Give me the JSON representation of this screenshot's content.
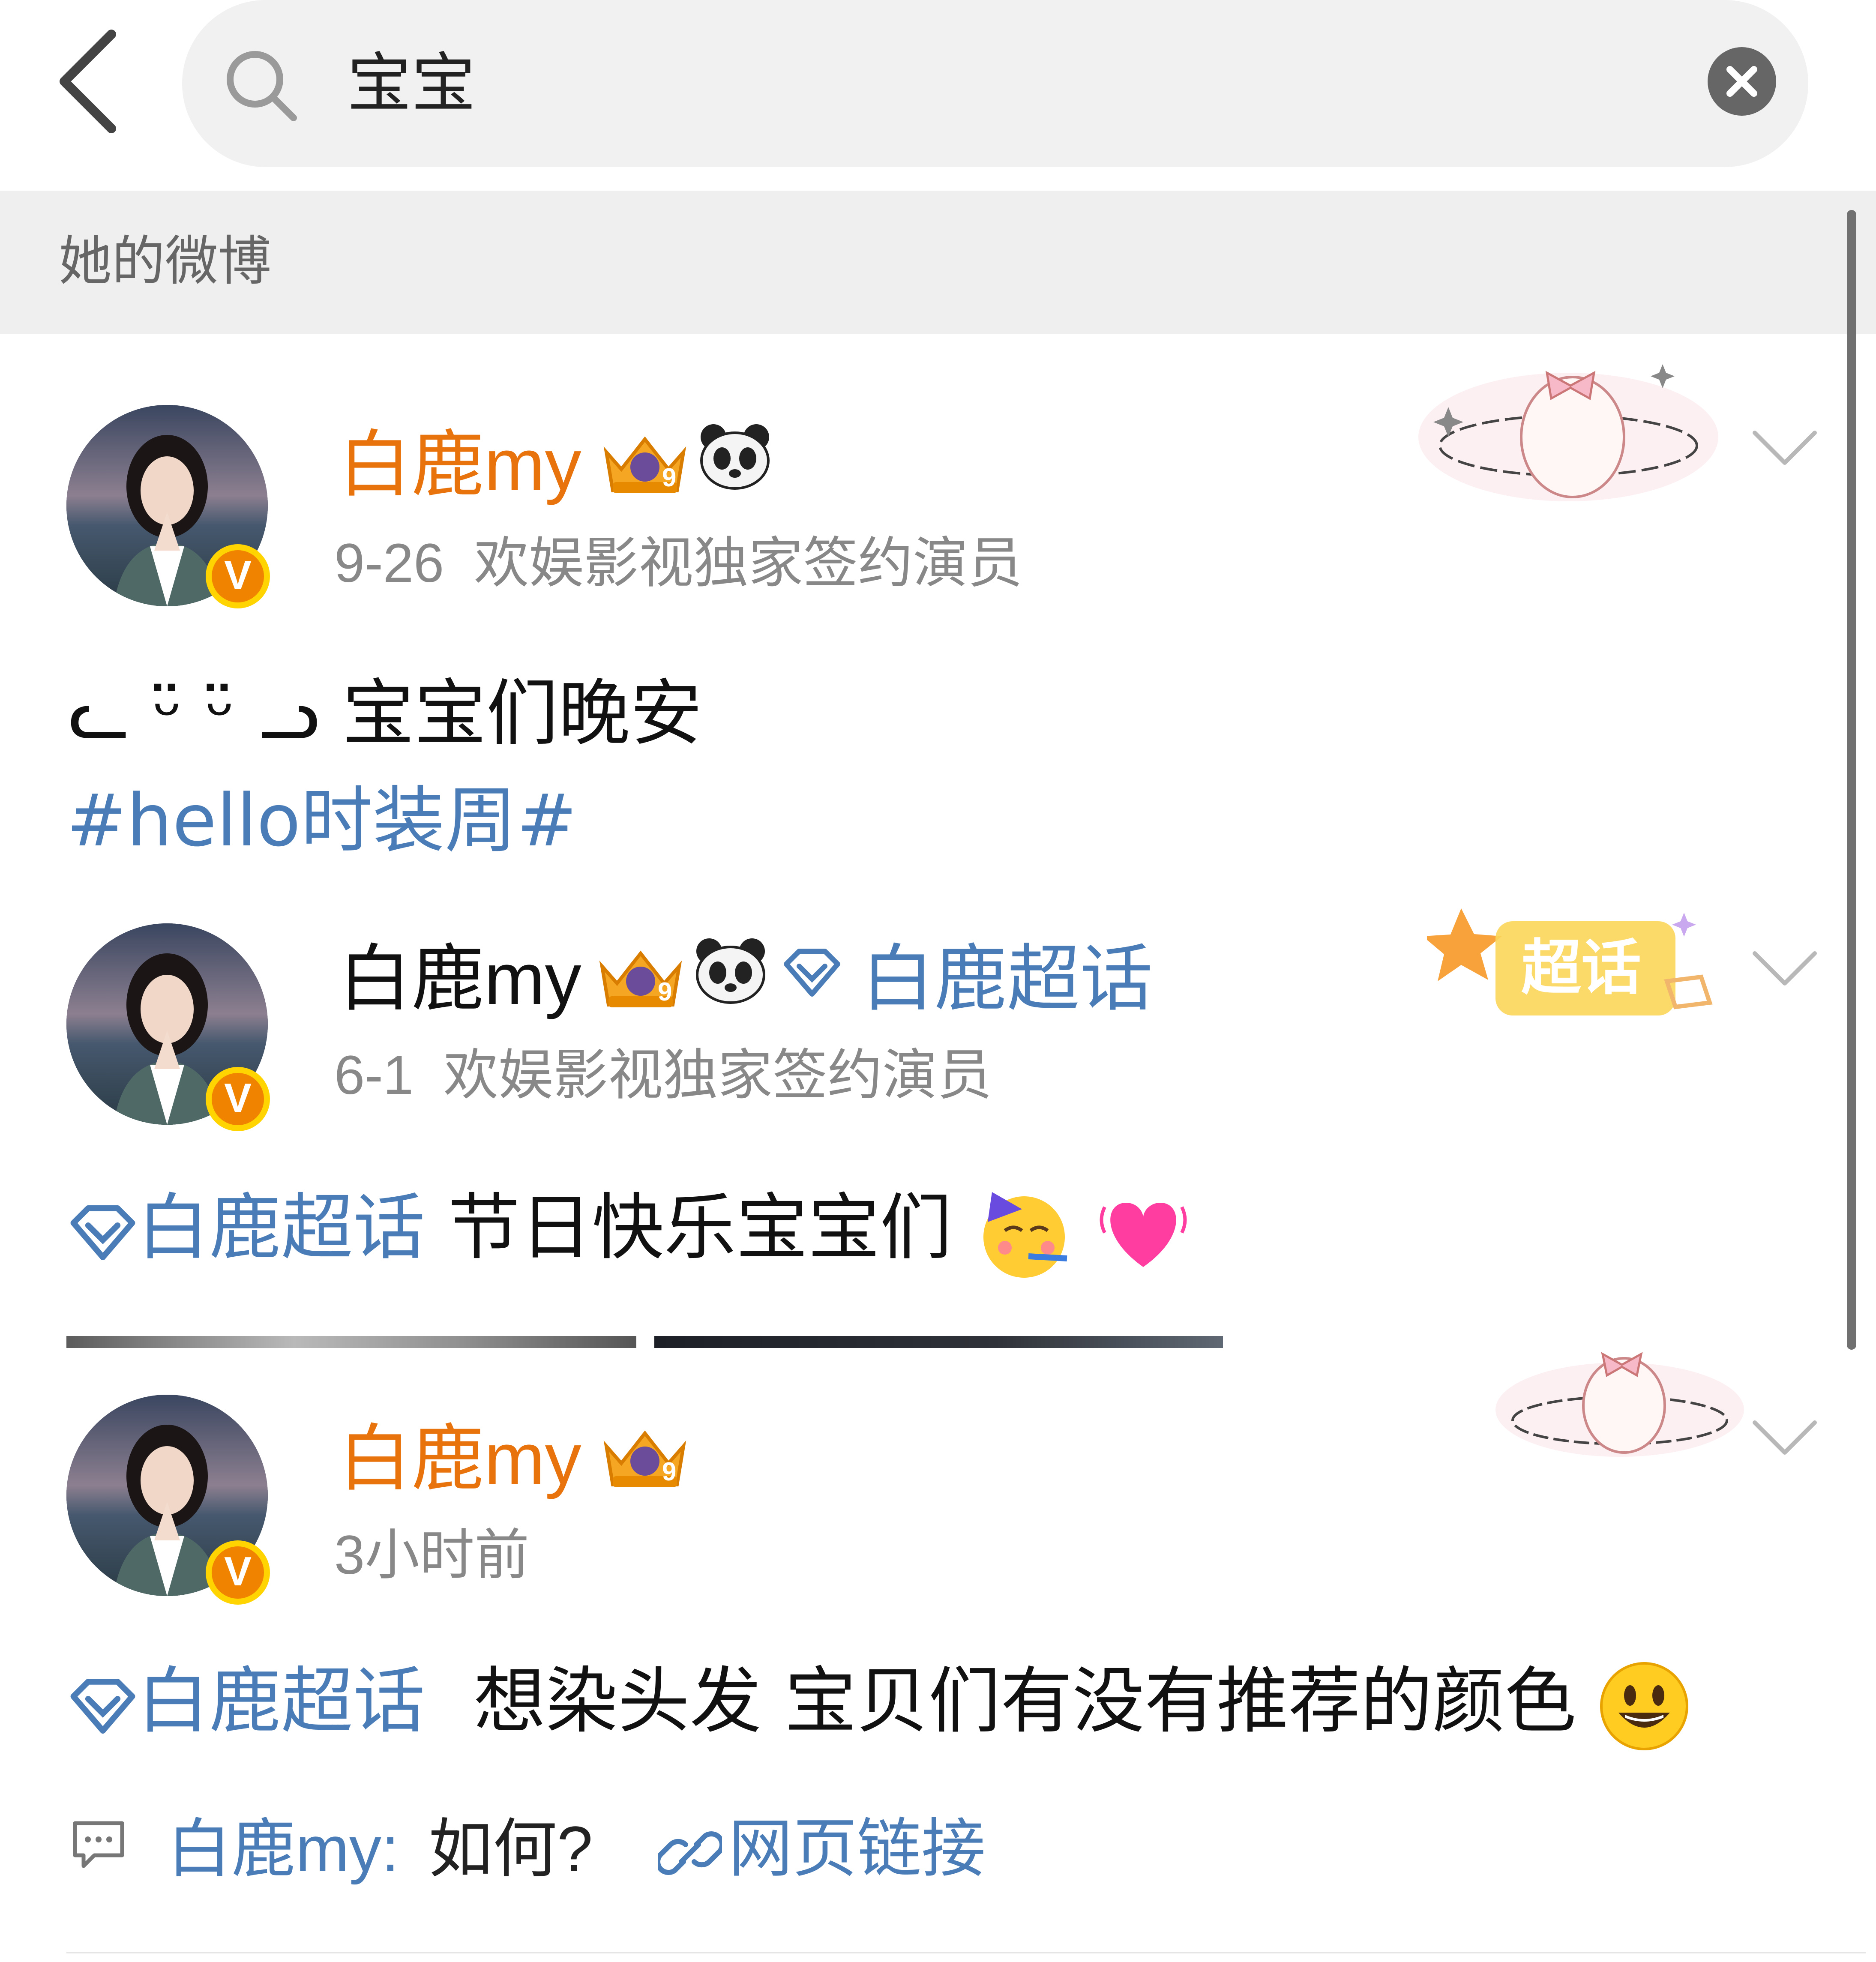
{
  "header": {
    "search_query": "宝宝"
  },
  "section": {
    "title": "她的微博"
  },
  "posts": [
    {
      "username": "白鹿my",
      "username_color": "#e8720c",
      "date": "9-26",
      "source": "欢娱影视独家签约演员",
      "text_prefix": "ᓚ ᵕ̈ ᵕ̈ ᓗ",
      "text": "宝宝们晚安",
      "hashtag": "#hello时装周#",
      "badge_level": "9",
      "verified_badge": "V",
      "decor": "bunny-sticker"
    },
    {
      "username": "白鹿my",
      "username_color": "#111111",
      "date": "6-1",
      "source": "欢娱影视独家签约演员",
      "supertopic_name": "白鹿超话",
      "text_topic": "白鹿超话",
      "text": "节日快乐宝宝们",
      "badge_level": "9",
      "verified_badge": "V",
      "decor_label": "超话"
    },
    {
      "username": "白鹿my",
      "username_color": "#e8720c",
      "time": "3小时前",
      "text_topic": "白鹿超话",
      "text": "想染头发 宝贝们有没有推荐的颜色",
      "badge_level": "9",
      "verified_badge": "V",
      "decor": "bunny-sticker"
    }
  ],
  "footer": {
    "comment_user": "白鹿my:",
    "comment_text": "如何?",
    "web_link": "网页链接"
  },
  "colors": {
    "accent_orange": "#e8720c",
    "link_blue": "#4a7db8",
    "gray_text": "#888888",
    "section_bg": "#efefef"
  },
  "icons": [
    "back-arrow-icon",
    "search-icon",
    "clear-icon",
    "chevron-down-icon",
    "crown-badge-icon",
    "panda-icon",
    "supertopic-diamond-icon",
    "party-face-emoji",
    "heart-emoji",
    "smiley-emoji",
    "comment-icon",
    "link-icon"
  ]
}
